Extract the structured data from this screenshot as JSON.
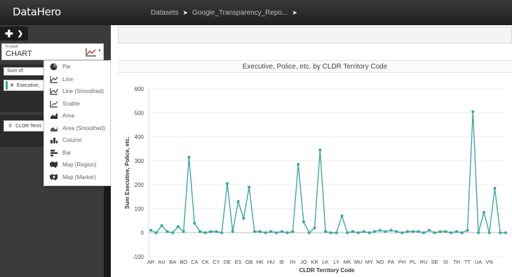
{
  "app": {
    "logo": "DataHero"
  },
  "breadcrumbs": [
    "Datasets",
    "Google_Transparency_Repo..."
  ],
  "left_panel": {
    "chart_prefix": "in your",
    "chart_label": "CHART",
    "sum_label": "Sum of:",
    "field_item": "Executive,",
    "field_hash": "#",
    "territory_item": "CLDR Territ"
  },
  "chart_menu": [
    {
      "label": "Pie",
      "icon": "pie-icon"
    },
    {
      "label": "Line",
      "icon": "line-icon"
    },
    {
      "label": "Line (Smoothed)",
      "icon": "line-smoothed-icon"
    },
    {
      "label": "Scatter",
      "icon": "scatter-icon"
    },
    {
      "label": "Area",
      "icon": "area-icon"
    },
    {
      "label": "Area (Smoothed)",
      "icon": "area-smoothed-icon"
    },
    {
      "label": "Column",
      "icon": "column-icon"
    },
    {
      "label": "Bar",
      "icon": "bar-icon"
    },
    {
      "label": "Map (Region)",
      "icon": "map-region-icon"
    },
    {
      "label": "Map (Marker)",
      "icon": "map-marker-icon"
    }
  ],
  "colors": {
    "series": "#3aa9a3",
    "topbar": "#2a2a2a",
    "panel": "#3b3b3b"
  },
  "chart_data": {
    "type": "line",
    "title": "Executive, Police, etc. by CLDR Territory Code",
    "xlabel": "CLDR Territory Code",
    "ylabel": "Sum Executive, Police, etc.",
    "ylim": [
      -100,
      600
    ],
    "yticks": [
      -100,
      0,
      100,
      200,
      300,
      400,
      500,
      600
    ],
    "x_tick_labels": [
      "AR",
      "AU",
      "BA",
      "BO",
      "CA",
      "CK",
      "CY",
      "DE",
      "ES",
      "GB",
      "HK",
      "HU",
      "IE",
      "IN",
      "JO",
      "KR",
      "LK",
      "LY",
      "MK",
      "MU",
      "MY",
      "NO",
      "PA",
      "PH",
      "PL",
      "RU",
      "SE",
      "SI",
      "TH",
      "TT",
      "UA",
      "VN"
    ],
    "grid": true,
    "legend": "none",
    "series": [
      {
        "values": [
          10,
          0,
          30,
          5,
          0,
          25,
          5,
          315,
          40,
          5,
          0,
          5,
          5,
          0,
          205,
          5,
          130,
          60,
          190,
          5,
          5,
          0,
          5,
          0,
          5,
          0,
          5,
          285,
          45,
          0,
          20,
          345,
          5,
          0,
          0,
          70,
          0,
          5,
          0,
          5,
          0,
          5,
          10,
          5,
          10,
          5,
          0,
          5,
          5,
          5,
          0,
          10,
          0,
          5,
          5,
          0,
          5,
          0,
          10,
          505,
          0,
          85,
          0,
          185,
          0,
          0
        ]
      }
    ]
  }
}
